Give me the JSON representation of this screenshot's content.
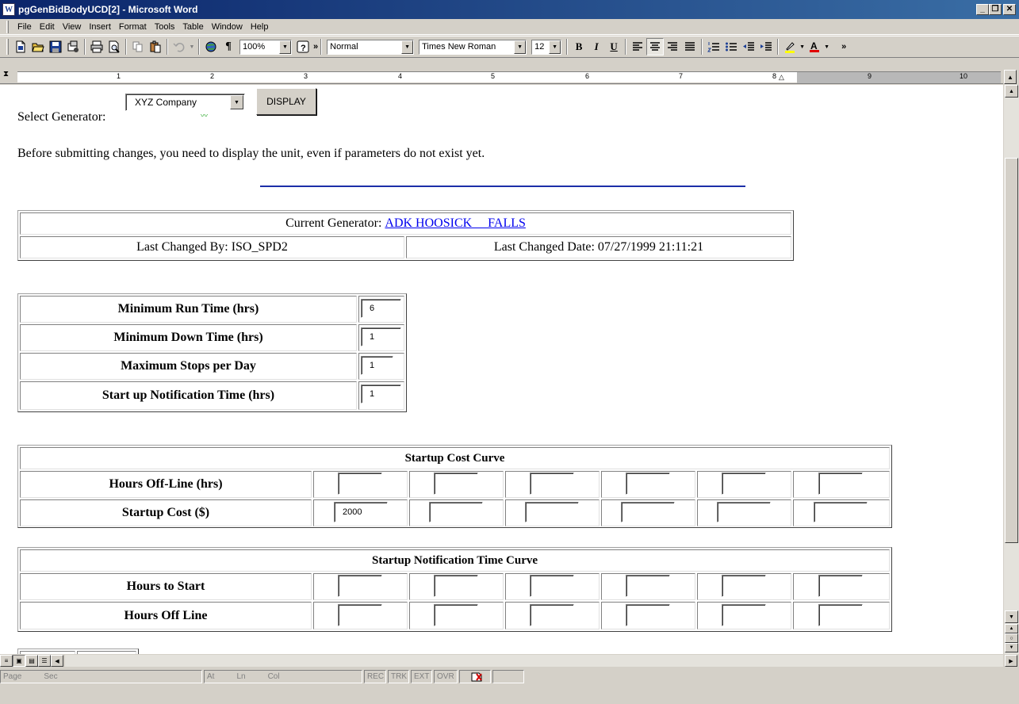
{
  "window": {
    "title": "pgGenBidBodyUCD[2] - Microsoft Word",
    "app_icon_letter": "W",
    "minimize": "_",
    "restore": "❐",
    "close": "✕"
  },
  "menu": [
    "File",
    "Edit",
    "View",
    "Insert",
    "Format",
    "Tools",
    "Table",
    "Window",
    "Help"
  ],
  "toolbar": {
    "zoom": "100%",
    "style": "Normal",
    "font": "Times New Roman",
    "font_size": "12",
    "bold": "B",
    "italic": "I",
    "underline": "U",
    "pilcrow": "¶"
  },
  "ruler": {
    "numbers": [
      "1",
      "2",
      "3",
      "4",
      "5",
      "6",
      "7",
      "8",
      "9",
      "10"
    ]
  },
  "document": {
    "select_label": "Select Generator:",
    "select_value": "XYZ Company",
    "display_button": "DISPLAY",
    "note": "Before submitting changes, you need to display the unit, even if parameters do not exist yet.",
    "current_generator_label": "Current Generator:",
    "current_generator_name": "ADK HOOSICK     FALLS",
    "last_changed_by": "Last Changed By: ISO_SPD2",
    "last_changed_date": "Last Changed Date: 07/27/1999 21:11:21",
    "params": [
      {
        "label": "Minimum Run Time (hrs)",
        "value": "6"
      },
      {
        "label": "Minimum Down Time (hrs)",
        "value": "1"
      },
      {
        "label": "Maximum Stops per Day",
        "value": "1"
      },
      {
        "label": "Start up Notification Time (hrs)",
        "value": "1"
      }
    ],
    "startup_cost": {
      "title": "Startup Cost Curve",
      "rows": [
        {
          "label": "Hours Off-Line (hrs)",
          "values": [
            "",
            "",
            "",
            "",
            "",
            ""
          ]
        },
        {
          "label": "Startup Cost ($)",
          "values": [
            "2000",
            "",
            "",
            "",
            "",
            ""
          ]
        }
      ]
    },
    "notification": {
      "title": "Startup Notification Time Curve",
      "rows": [
        {
          "label": "Hours to Start",
          "values": [
            "",
            "",
            "",
            "",
            "",
            ""
          ]
        },
        {
          "label": "Hours Off Line",
          "values": [
            "",
            "",
            "",
            "",
            "",
            ""
          ]
        }
      ]
    }
  },
  "status": {
    "page": "Page",
    "sec": "Sec",
    "at": "At",
    "ln": "Ln",
    "col": "Col",
    "rec": "REC",
    "trk": "TRK",
    "ext": "EXT",
    "ovr": "OVR"
  }
}
